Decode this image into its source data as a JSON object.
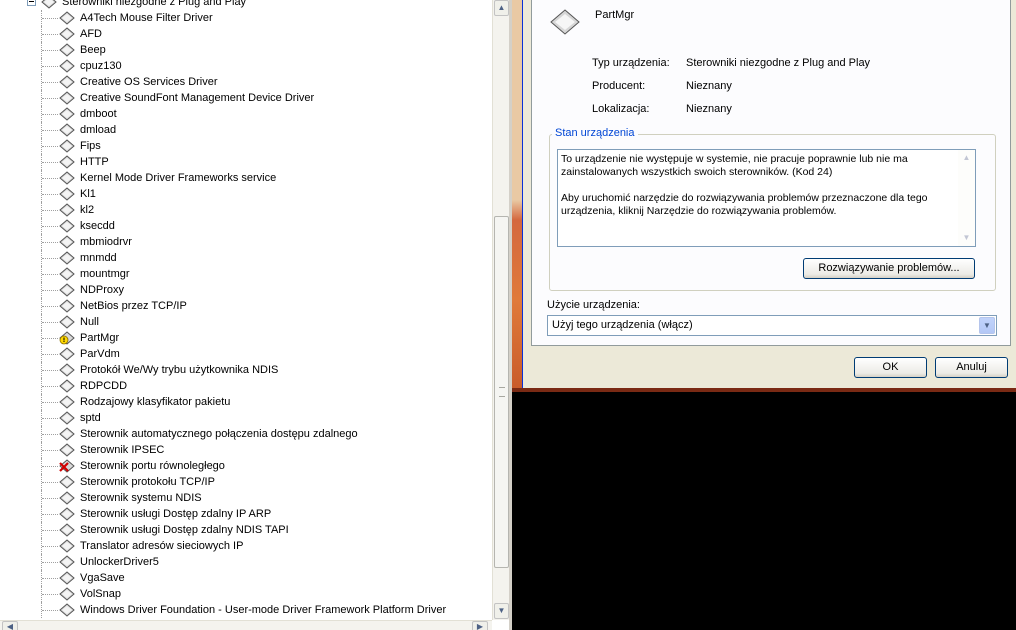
{
  "tree": {
    "category_label": "Sterowniki niezgodne z Plug and Play",
    "items": [
      {
        "label": "A4Tech Mouse Filter Driver",
        "status": "normal"
      },
      {
        "label": "AFD",
        "status": "normal"
      },
      {
        "label": "Beep",
        "status": "normal"
      },
      {
        "label": "cpuz130",
        "status": "normal"
      },
      {
        "label": "Creative OS Services Driver",
        "status": "normal"
      },
      {
        "label": "Creative SoundFont Management Device Driver",
        "status": "normal"
      },
      {
        "label": "dmboot",
        "status": "normal"
      },
      {
        "label": "dmload",
        "status": "normal"
      },
      {
        "label": "Fips",
        "status": "normal"
      },
      {
        "label": "HTTP",
        "status": "normal"
      },
      {
        "label": "Kernel Mode Driver Frameworks service",
        "status": "normal"
      },
      {
        "label": "Kl1",
        "status": "normal"
      },
      {
        "label": "kl2",
        "status": "normal"
      },
      {
        "label": "ksecdd",
        "status": "normal"
      },
      {
        "label": "mbmiodrvr",
        "status": "normal"
      },
      {
        "label": "mnmdd",
        "status": "normal"
      },
      {
        "label": "mountmgr",
        "status": "normal"
      },
      {
        "label": "NDProxy",
        "status": "normal"
      },
      {
        "label": "NetBios przez TCP/IP",
        "status": "normal"
      },
      {
        "label": "Null",
        "status": "normal"
      },
      {
        "label": "PartMgr",
        "status": "warning"
      },
      {
        "label": "ParVdm",
        "status": "normal"
      },
      {
        "label": "Protokół We/Wy trybu użytkownika NDIS",
        "status": "normal"
      },
      {
        "label": "RDPCDD",
        "status": "normal"
      },
      {
        "label": "Rodzajowy klasyfikator pakietu",
        "status": "normal"
      },
      {
        "label": "sptd",
        "status": "normal"
      },
      {
        "label": "Sterownik automatycznego połączenia dostępu zdalnego",
        "status": "normal"
      },
      {
        "label": "Sterownik IPSEC",
        "status": "normal"
      },
      {
        "label": "Sterownik portu równoległego",
        "status": "disabled"
      },
      {
        "label": "Sterownik protokołu TCP/IP",
        "status": "normal"
      },
      {
        "label": "Sterownik systemu NDIS",
        "status": "normal"
      },
      {
        "label": "Sterownik usługi Dostęp zdalny IP ARP",
        "status": "normal"
      },
      {
        "label": "Sterownik usługi Dostęp zdalny NDIS TAPI",
        "status": "normal"
      },
      {
        "label": "Translator adresów sieciowych IP",
        "status": "normal"
      },
      {
        "label": "UnlockerDriver5",
        "status": "normal"
      },
      {
        "label": "VgaSave",
        "status": "normal"
      },
      {
        "label": "VolSnap",
        "status": "normal"
      },
      {
        "label": "Windows Driver Foundation - User-mode Driver Framework Platform Driver",
        "status": "normal"
      }
    ]
  },
  "dialog": {
    "device_name": "PartMgr",
    "properties": [
      {
        "label": "Typ urządzenia:",
        "value": "Sterowniki niezgodne z Plug and Play"
      },
      {
        "label": "Producent:",
        "value": "Nieznany"
      },
      {
        "label": "Lokalizacja:",
        "value": "Nieznany"
      }
    ],
    "status_group_label": "Stan urządzenia",
    "status_paragraph_1": "To urządzenie nie występuje w systemie, nie pracuje poprawnie lub nie ma zainstalowanych wszystkich swoich sterowników. (Kod 24)",
    "status_paragraph_2": "Aby uruchomić narzędzie do rozwiązywania problemów przeznaczone dla tego urządzenia, kliknij Narzędzie do rozwiązywania problemów.",
    "troubleshoot_button": "Rozwiązywanie problemów...",
    "usage_label": "Użycie urządzenia:",
    "usage_value": "Użyj tego urządzenia (włącz)",
    "ok_button": "OK",
    "cancel_button": "Anuluj"
  },
  "colors": {
    "group_label": "#0046d5",
    "button_border": "#003c74",
    "window_bg": "#ece9d8"
  }
}
